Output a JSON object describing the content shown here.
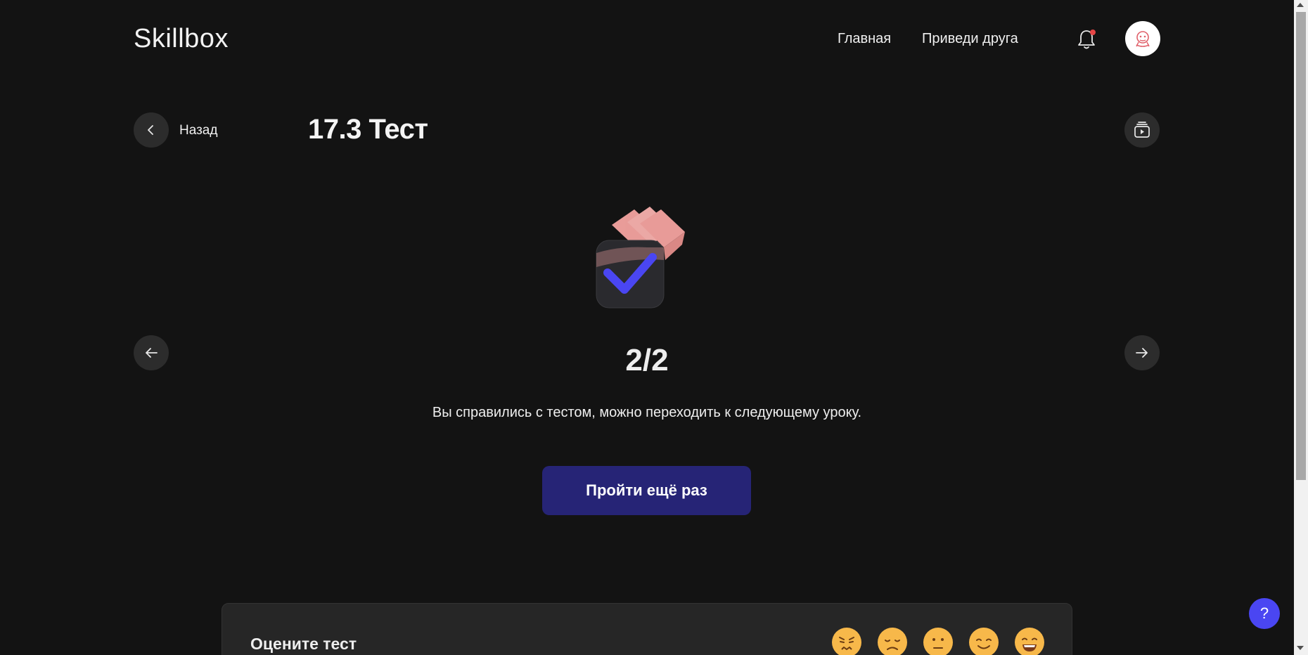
{
  "header": {
    "logo": "Skillbox",
    "nav": [
      {
        "label": "Главная"
      },
      {
        "label": "Приведи друга"
      }
    ]
  },
  "lesson": {
    "back_label": "Назад",
    "title": "17.3 Тест"
  },
  "result": {
    "score": "2/2",
    "message": "Вы справились с тестом, можно переходить к следующему уроку.",
    "retry_label": "Пройти ещё раз"
  },
  "rating": {
    "label": "Оцените тест",
    "emojis": [
      "angry-face-icon",
      "sad-face-icon",
      "neutral-face-icon",
      "smiling-face-icon",
      "grinning-face-icon"
    ]
  },
  "help": {
    "label": "?"
  },
  "colors": {
    "background": "#131313",
    "primary_button": "#262476",
    "help_button": "#4a46f2",
    "check_mark": "#4a46f2",
    "notification_dot": "#e64545"
  }
}
